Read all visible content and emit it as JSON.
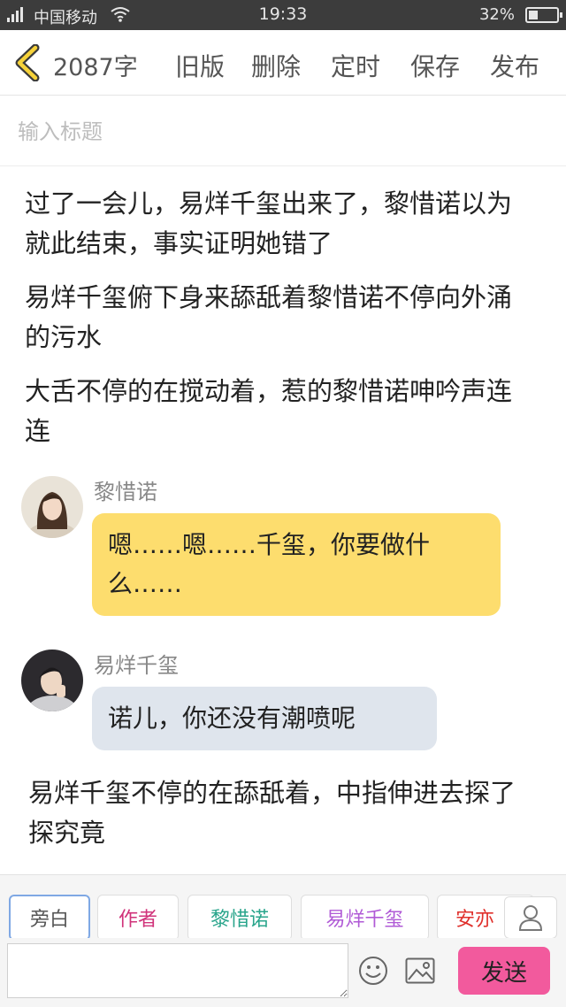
{
  "status_bar": {
    "carrier": "中国移动",
    "time": "19:33",
    "battery": "32%",
    "battery_level": 0.32,
    "icons": [
      "signal-icon",
      "wifi-icon",
      "battery-icon"
    ]
  },
  "nav": {
    "back_icon": "chevron-left-icon",
    "word_count": "2087字",
    "old_version": "旧版",
    "delete": "删除",
    "schedule": "定时",
    "save": "保存",
    "publish": "发布"
  },
  "title_input": {
    "placeholder": "输入标题",
    "value": ""
  },
  "content": {
    "paragraphs": [
      "过了一会儿，易烊千玺出来了，黎惜诺以为就此结束，事实证明她错了",
      "易烊千玺俯下身来舔舐着黎惜诺不停向外涌的污水",
      "大舌不停的在搅动着，惹的黎惜诺呻吟声连连"
    ],
    "dialogues": [
      {
        "speaker": "黎惜诺",
        "text": "嗯……嗯……千玺，你要做什么……",
        "bubble_color": "#fddd6e"
      },
      {
        "speaker": "易烊千玺",
        "text": "诺儿，你还没有潮喷呢",
        "bubble_color": "#dfe5ed"
      }
    ],
    "after_paragraph": "易烊千玺不停的在舔舐着，中指伸进去探了探究竟"
  },
  "roles": [
    {
      "label": "旁白",
      "color": "#555555",
      "active": true
    },
    {
      "label": "作者",
      "color": "#d0337a",
      "active": false
    },
    {
      "label": "黎惜诺",
      "color": "#2aa58c",
      "active": false
    },
    {
      "label": "易烊千玺",
      "color": "#b05ad6",
      "active": false
    },
    {
      "label": "安亦",
      "color": "#e0302b",
      "active": false
    }
  ],
  "composer": {
    "placeholder": "",
    "value": "",
    "send": "发送",
    "emoji_icon": "emoji-icon",
    "image_icon": "image-icon",
    "person_icon": "person-icon"
  }
}
